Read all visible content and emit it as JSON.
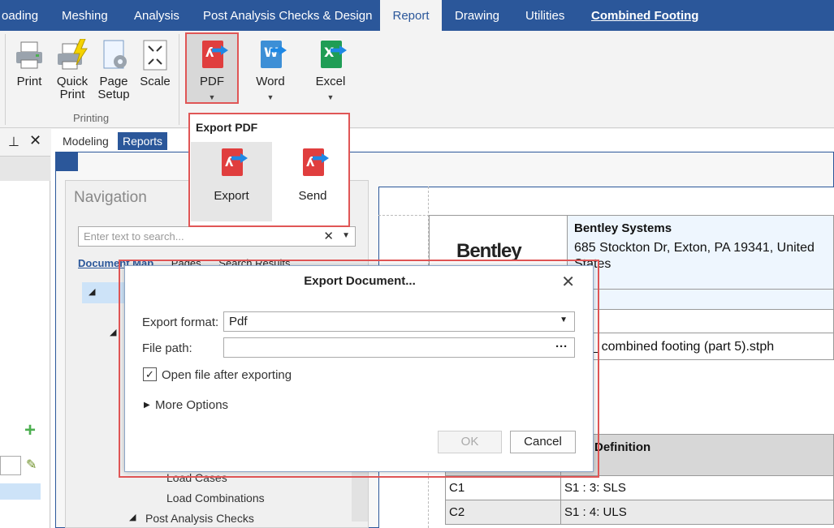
{
  "ribbon_tabs": [
    "oading",
    "Meshing",
    "Analysis",
    "Post Analysis Checks & Design",
    "Report",
    "Drawing",
    "Utilities",
    "Combined Footing"
  ],
  "ribbon": {
    "print": "Print",
    "quick_print_1": "Quick",
    "quick_print_2": "Print",
    "page_setup_1": "Page",
    "page_setup_2": "Setup",
    "scale": "Scale",
    "printing_group": "Printing",
    "pdf": "PDF",
    "word": "Word",
    "excel": "Excel"
  },
  "doc_tabs": {
    "modeling": "Modeling",
    "reports": "Reports"
  },
  "navigation": {
    "title": "Navigation",
    "search_placeholder": "Enter text to search...",
    "tabs": [
      "Document Map",
      "Pages",
      "Search Results"
    ],
    "tree": [
      "Load Cases",
      "Load Combinations",
      "Post Analysis Checks"
    ]
  },
  "pdf_dropdown": {
    "title": "Export PDF",
    "export": "Export",
    "send": "Send"
  },
  "report": {
    "logo": "Bentley",
    "company": "Bentley Systems",
    "address": "685 Stockton Dr, Exton, PA 19341, United States",
    "file_fragment": "n 2_ combined footing (part 5).stph",
    "definition_header": "Definition",
    "rows": [
      {
        "id": "C1",
        "def": "S1 : 3: SLS"
      },
      {
        "id": "C2",
        "def": "S1 : 4: ULS"
      }
    ]
  },
  "dialog": {
    "title": "Export Document...",
    "format_label": "Export format:",
    "format_value": "Pdf",
    "path_label": "File path:",
    "path_button": "···",
    "open_after": "Open file after exporting",
    "more_options": "More Options",
    "ok": "OK",
    "cancel": "Cancel"
  }
}
